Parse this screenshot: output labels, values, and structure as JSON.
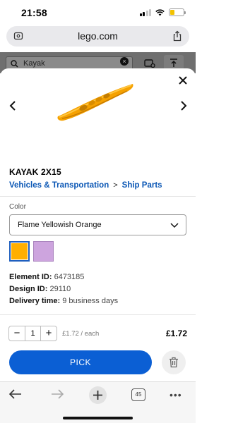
{
  "status_bar": {
    "time": "21:58"
  },
  "browser": {
    "url": "lego.com",
    "open_tabs": "45"
  },
  "background_page": {
    "search_value": "Kayak"
  },
  "product": {
    "name": "KAYAK 2X15",
    "breadcrumb": [
      "Vehicles & Transportation",
      "Ship Parts"
    ],
    "breadcrumb_separator": ">",
    "color_label": "Color",
    "color_selected": "Flame Yellowish Orange",
    "swatches": [
      {
        "name": "swatch-flame-yellowish-orange",
        "color": "#ffaf00",
        "selected": true
      },
      {
        "name": "swatch-lavender",
        "color": "#cda4de",
        "selected": false
      }
    ],
    "element_id_label": "Element ID:",
    "element_id": "6473185",
    "design_id_label": "Design ID:",
    "design_id": "29110",
    "delivery_label": "Delivery time:",
    "delivery_time": "9 business days"
  },
  "cart": {
    "quantity": "1",
    "decrement": "−",
    "increment": "+",
    "unit_price": "£1.72 / each",
    "total": "£1.72",
    "pick_label": "PICK"
  },
  "colors": {
    "accent": "#0b5fd4",
    "link": "#0b57b5"
  }
}
